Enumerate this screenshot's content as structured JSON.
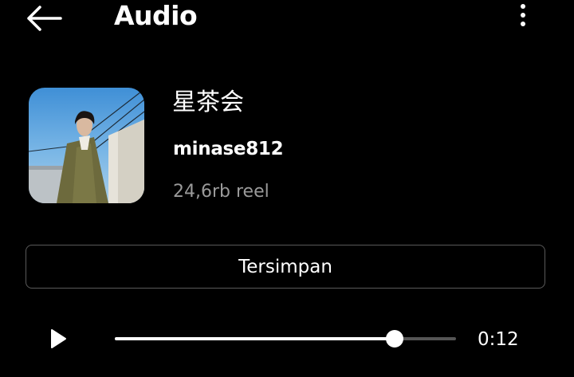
{
  "header": {
    "title": "Audio",
    "back_icon": "arrow-left-icon",
    "more_icon": "more-vertical-icon"
  },
  "audio": {
    "title": "星茶会",
    "artist": "minase812",
    "reels_count": "24,6rb reel",
    "cover_icon": "album-cover-image"
  },
  "actions": {
    "saved_label": "Tersimpan"
  },
  "player": {
    "play_icon": "play-icon",
    "progress_fraction": 0.82,
    "time": "0:12"
  },
  "colors": {
    "background": "#000000",
    "text": "#ffffff",
    "secondary_text": "#9a9a9a",
    "border": "#5a5a5a",
    "track": "#555555"
  }
}
